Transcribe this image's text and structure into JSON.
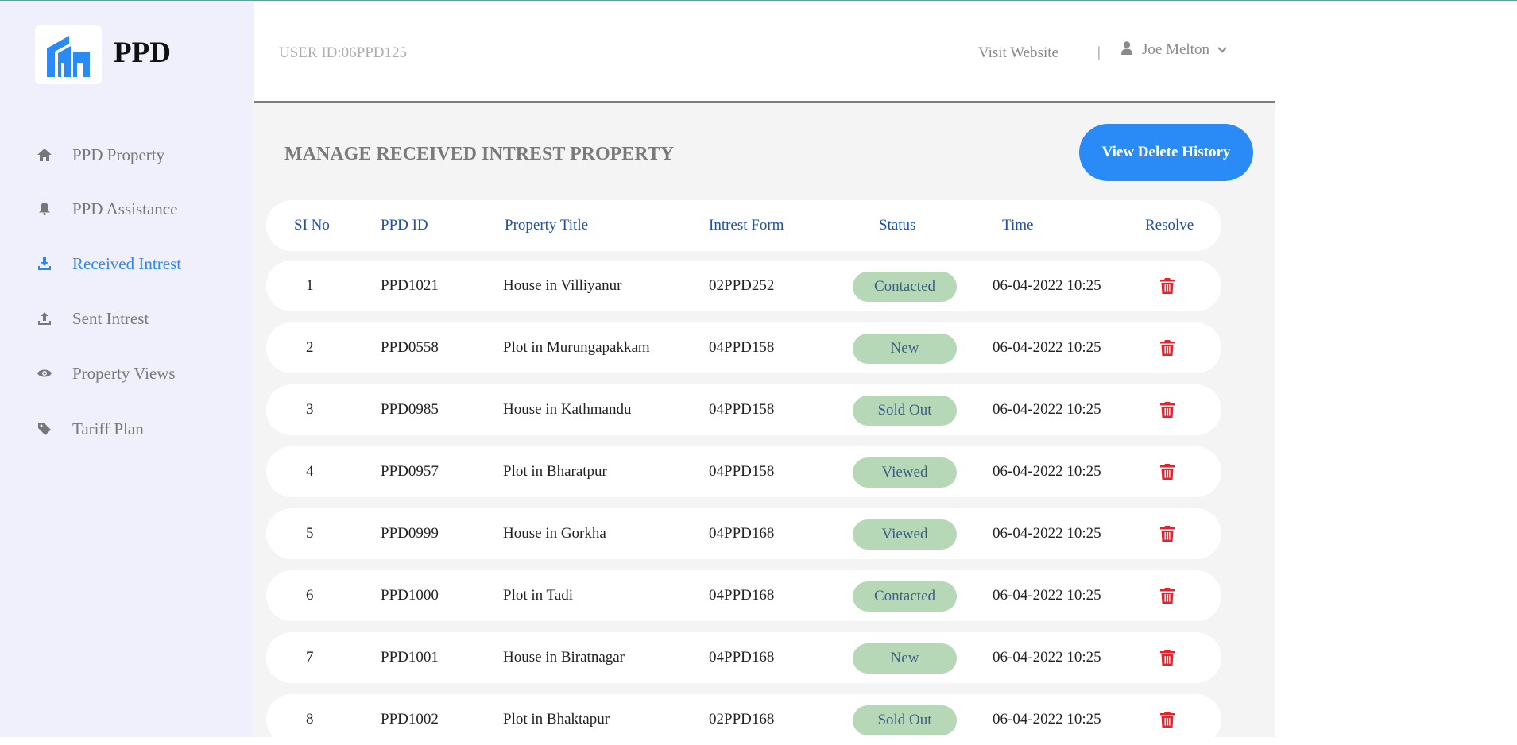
{
  "app": {
    "logo_text": "PPD"
  },
  "colors": {
    "accent": "#2a8af6",
    "sidebar_bg": "#f0f0fd",
    "status_badge_bg": "#b6d8b6",
    "delete_red": "#e8212d"
  },
  "header": {
    "user_id": "USER ID:06PPD125",
    "visit_website": "Visit Website",
    "separator": "|",
    "user_name": "Joe Melton"
  },
  "sidebar": {
    "items": [
      {
        "label": "PPD Property",
        "icon": "home-icon"
      },
      {
        "label": "PPD Assistance",
        "icon": "bell-icon"
      },
      {
        "label": "Received Intrest",
        "icon": "download-icon",
        "active": true
      },
      {
        "label": "Sent Intrest",
        "icon": "upload-icon"
      },
      {
        "label": "Property Views",
        "icon": "eye-icon"
      },
      {
        "label": "Tariff Plan",
        "icon": "tag-icon"
      }
    ]
  },
  "main": {
    "title": "MANAGE RECEIVED INTREST PROPERTY",
    "delete_history_button": "View Delete History"
  },
  "table": {
    "headers": [
      "SI No",
      "PPD ID",
      "Property Title",
      "Intrest Form",
      "Status",
      "Time",
      "Resolve"
    ],
    "rows": [
      {
        "si": "1",
        "ppd_id": "PPD1021",
        "title": "House in Villiyanur",
        "form": "02PPD252",
        "status": "Contacted",
        "time": "06-04-2022 10:25",
        "resolve_icon": "trash-icon"
      },
      {
        "si": "2",
        "ppd_id": "PPD0558",
        "title": "Plot in Murungapakkam",
        "form": "04PPD158",
        "status": "New",
        "time": "06-04-2022 10:25",
        "resolve_icon": "trash-icon"
      },
      {
        "si": "3",
        "ppd_id": "PPD0985",
        "title": "House in Kathmandu",
        "form": "04PPD158",
        "status": "Sold Out",
        "time": "06-04-2022 10:25",
        "resolve_icon": "trash-icon"
      },
      {
        "si": "4",
        "ppd_id": "PPD0957",
        "title": "Plot in Bharatpur",
        "form": "04PPD158",
        "status": "Viewed",
        "time": "06-04-2022 10:25",
        "resolve_icon": "trash-icon"
      },
      {
        "si": "5",
        "ppd_id": "PPD0999",
        "title": "House in Gorkha",
        "form": "04PPD168",
        "status": "Viewed",
        "time": "06-04-2022 10:25",
        "resolve_icon": "trash-icon"
      },
      {
        "si": "6",
        "ppd_id": "PPD1000",
        "title": "Plot in Tadi",
        "form": "04PPD168",
        "status": "Contacted",
        "time": "06-04-2022 10:25",
        "resolve_icon": "trash-icon"
      },
      {
        "si": "7",
        "ppd_id": "PPD1001",
        "title": "House in Biratnagar",
        "form": "04PPD168",
        "status": "New",
        "time": "06-04-2022 10:25",
        "resolve_icon": "trash-icon"
      },
      {
        "si": "8",
        "ppd_id": "PPD1002",
        "title": "Plot in Bhaktapur",
        "form": "02PPD168",
        "status": "Sold Out",
        "time": "06-04-2022 10:25",
        "resolve_icon": "trash-icon"
      }
    ]
  }
}
